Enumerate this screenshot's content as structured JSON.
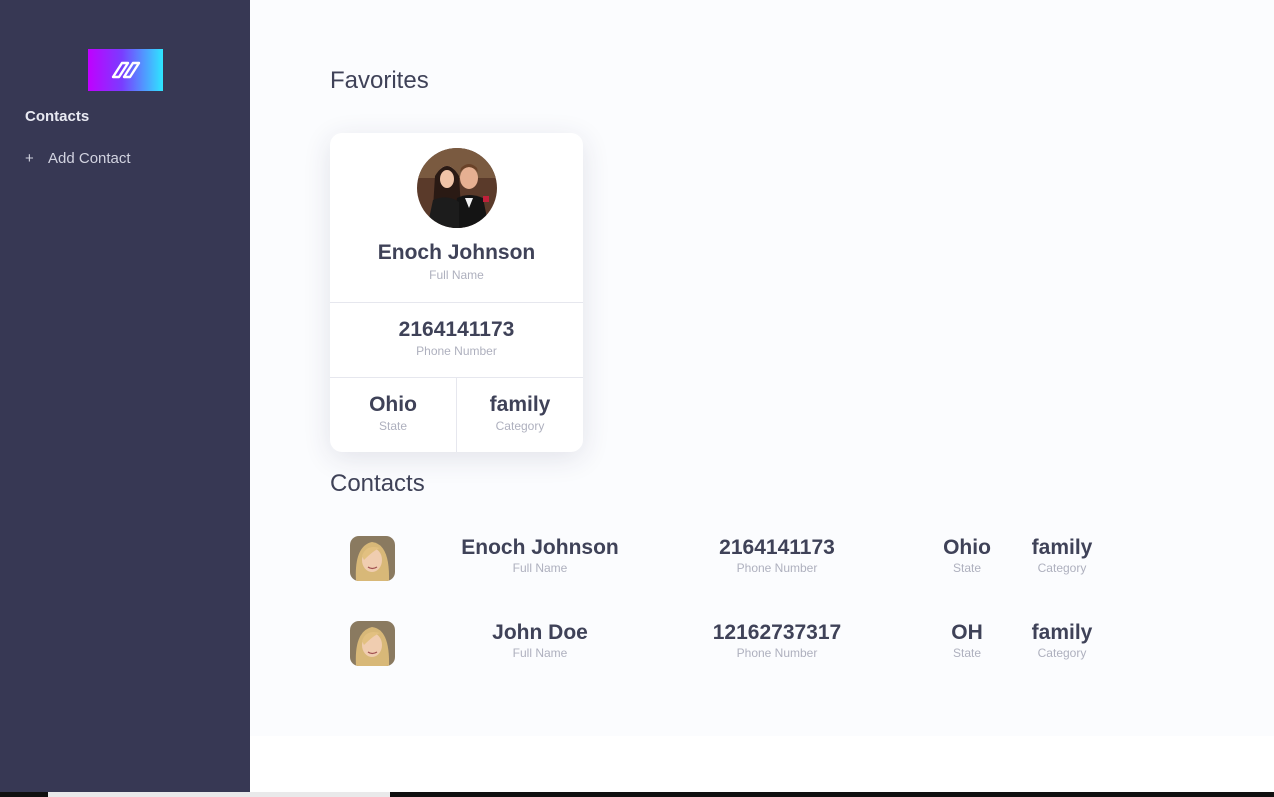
{
  "sidebar": {
    "nav_title": "Contacts",
    "add_icon": "+",
    "add_label": "Add Contact"
  },
  "favorites": {
    "title": "Favorites",
    "card": {
      "name": "Enoch Johnson",
      "name_label": "Full Name",
      "phone": "2164141173",
      "phone_label": "Phone Number",
      "state": "Ohio",
      "state_label": "State",
      "category": "family",
      "category_label": "Category"
    }
  },
  "contacts": {
    "title": "Contacts",
    "rows": [
      {
        "name": "Enoch Johnson",
        "name_label": "Full Name",
        "phone": "2164141173",
        "phone_label": "Phone Number",
        "state": "Ohio",
        "state_label": "State",
        "category": "family",
        "category_label": "Category"
      },
      {
        "name": "John Doe",
        "name_label": "Full Name",
        "phone": "12162737317",
        "phone_label": "Phone Number",
        "state": "OH",
        "state_label": "State",
        "category": "family",
        "category_label": "Category"
      }
    ]
  },
  "colors": {
    "sidebar_bg": "#373854",
    "main_bg": "#fbfcfe",
    "text_dark": "#3f4258",
    "text_muted": "#aeb0be",
    "logo_gradient_start": "#c000ff",
    "logo_gradient_end": "#2ee6ff"
  },
  "icons": {
    "logo": "brand-logo-icon",
    "add": "plus-icon",
    "favorite_avatar": "couple-photo-avatar",
    "row_avatar": "woman-photo-avatar"
  }
}
